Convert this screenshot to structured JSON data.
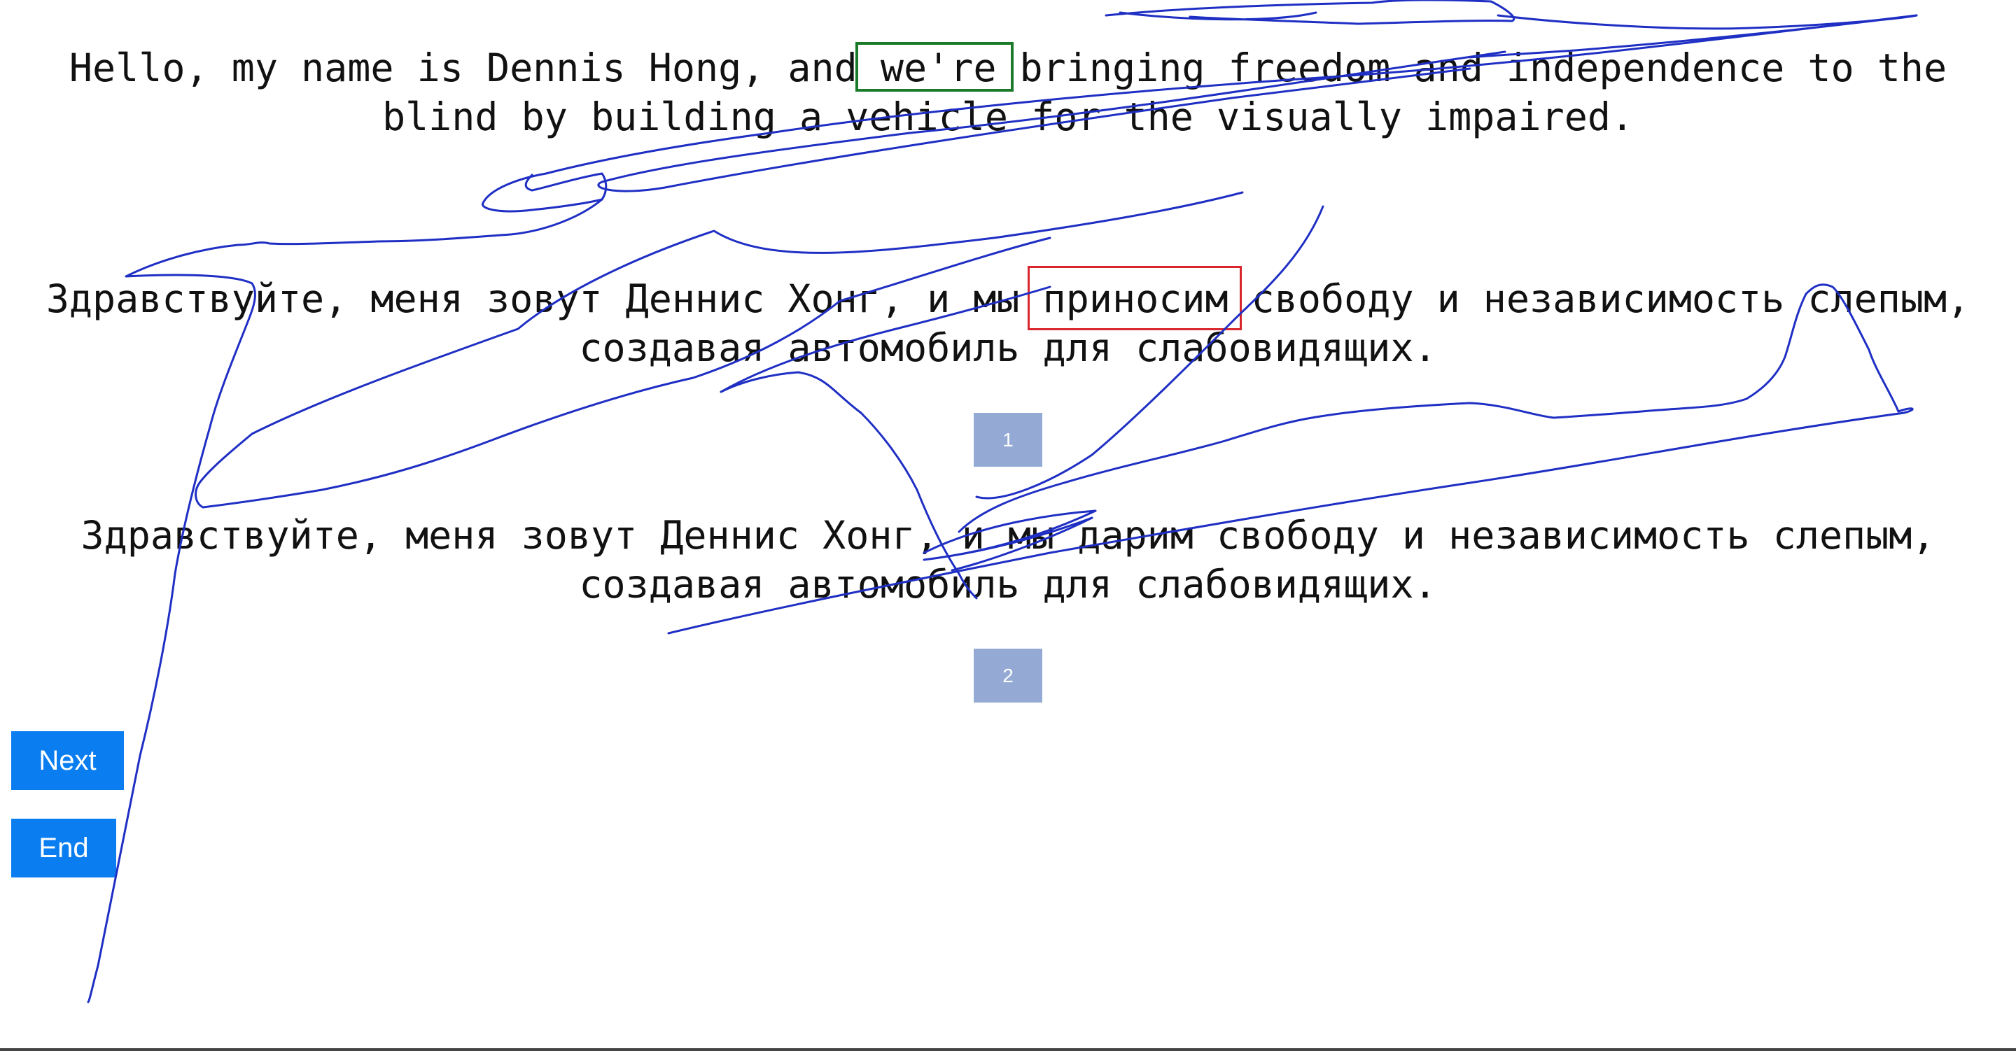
{
  "sentences": {
    "english": "Hello, my name is Dennis Hong, and we're bringing freedom and independence to the\nblind by building a vehicle for the visually impaired.",
    "russian_1": "Здравствуйте, меня зовут Деннис Хонг, и мы приносим свободу и независимость слепым,\nсоздавая автомобиль для слабовидящих.",
    "russian_2": "Здравствуйте, меня зовут Деннис Хонг, и мы дарим свободу и независимость слепым,\nсоздавая автомобиль для слабовидящих."
  },
  "badges": {
    "first": "1",
    "second": "2"
  },
  "buttons": {
    "next_label": "Next",
    "end_label": "End"
  },
  "colors": {
    "source_highlight": "#1a7a2a",
    "target_highlight": "#d9262c",
    "badge": "#94a9d4",
    "button": "#0a7df0",
    "scribble": "#1f2fc4"
  }
}
